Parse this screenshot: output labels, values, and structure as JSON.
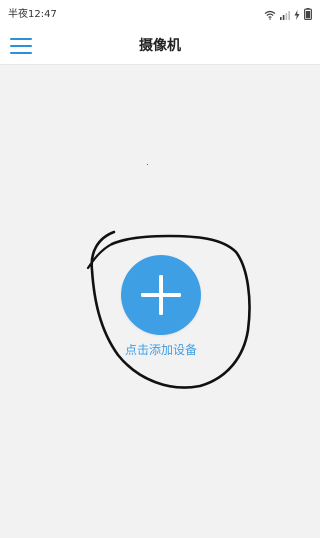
{
  "status_bar": {
    "time": "半夜12:47",
    "icons": [
      "wifi-icon",
      "signal-icon",
      "charging-icon",
      "battery-icon"
    ]
  },
  "app_bar": {
    "title": "摄像机",
    "menu_icon": "hamburger-menu-icon"
  },
  "main": {
    "add_button_icon": "plus-icon",
    "add_device_label": "点击添加设备"
  },
  "colors": {
    "accent": "#3e9fe5",
    "menu": "#2b90d9",
    "background": "#f3f2f3",
    "annotation": "#111111"
  }
}
